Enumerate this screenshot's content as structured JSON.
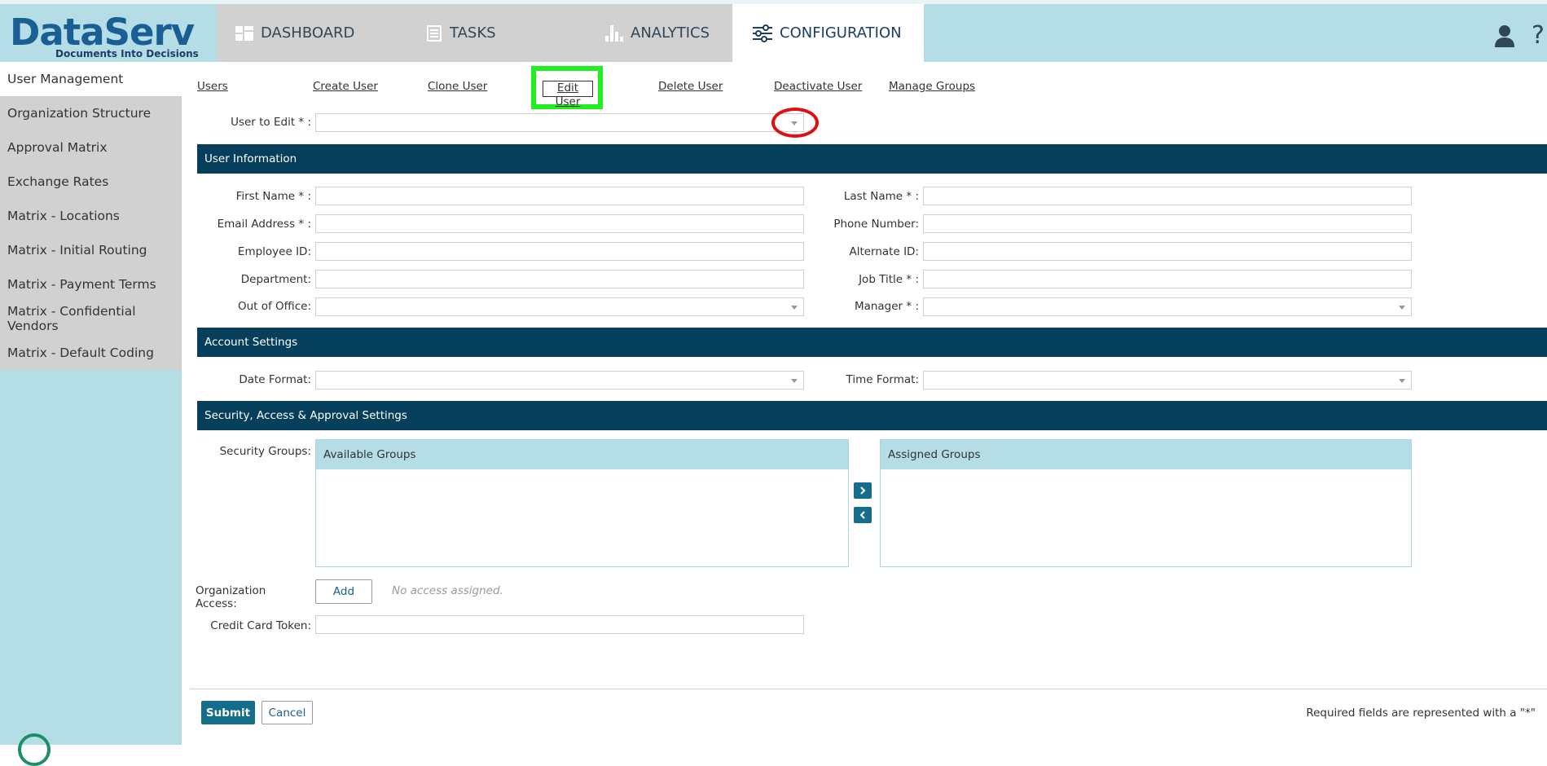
{
  "brand": {
    "name": "DataServ",
    "tagline": "Documents Into Decisions"
  },
  "nav_tabs": [
    {
      "label": "DASHBOARD",
      "icon": "dashboard-icon"
    },
    {
      "label": "TASKS",
      "icon": "tasks-icon"
    },
    {
      "label": "ANALYTICS",
      "icon": "analytics-icon"
    },
    {
      "label": "CONFIGURATION",
      "icon": "configuration-icon",
      "active": true
    }
  ],
  "header_icons": [
    "user-icon",
    "help-icon"
  ],
  "sidebar": {
    "items": [
      {
        "label": "User Management",
        "active": true
      },
      {
        "label": "Organization Structure"
      },
      {
        "label": "Approval Matrix"
      },
      {
        "label": "Exchange Rates"
      },
      {
        "label": "Matrix - Locations"
      },
      {
        "label": "Matrix - Initial Routing"
      },
      {
        "label": "Matrix - Payment Terms"
      },
      {
        "label": "Matrix - Confidential Vendors"
      },
      {
        "label": "Matrix - Default Coding"
      }
    ]
  },
  "sub_links": [
    "Users",
    "Create User",
    "Clone User",
    "Edit User",
    "Delete User",
    "Deactivate User",
    "Manage Groups"
  ],
  "user_to_edit": {
    "label": "User to Edit * :",
    "value": ""
  },
  "sections": {
    "user_info": "User Information",
    "account": "Account Settings",
    "security": "Security, Access & Approval Settings"
  },
  "user_fields": {
    "first_name": "First Name * :",
    "last_name": "Last Name * :",
    "email": "Email Address * :",
    "phone": "Phone Number:",
    "employee_id": "Employee ID:",
    "alternate_id": "Alternate ID:",
    "department": "Department:",
    "job_title": "Job Title * :",
    "out_of_office": "Out of Office:",
    "manager": "Manager * :"
  },
  "account_fields": {
    "date_format": "Date Format:",
    "time_format": "Time Format:"
  },
  "security": {
    "groups_label": "Security Groups:",
    "available": "Available Groups",
    "assigned": "Assigned Groups",
    "org_access_label": "Organization Access:",
    "add_label": "Add",
    "no_access": "No access assigned.",
    "credit_card_label": "Credit Card Token:"
  },
  "footer": {
    "submit": "Submit",
    "cancel": "Cancel",
    "required_note": "Required fields are represented with a \"*\""
  },
  "colors": {
    "header_bg": "#b5dde6",
    "section_bg": "#063f5c",
    "primary_button": "#156d8c",
    "highlight_green": "#22ee22",
    "annotation_red": "#e01010"
  }
}
